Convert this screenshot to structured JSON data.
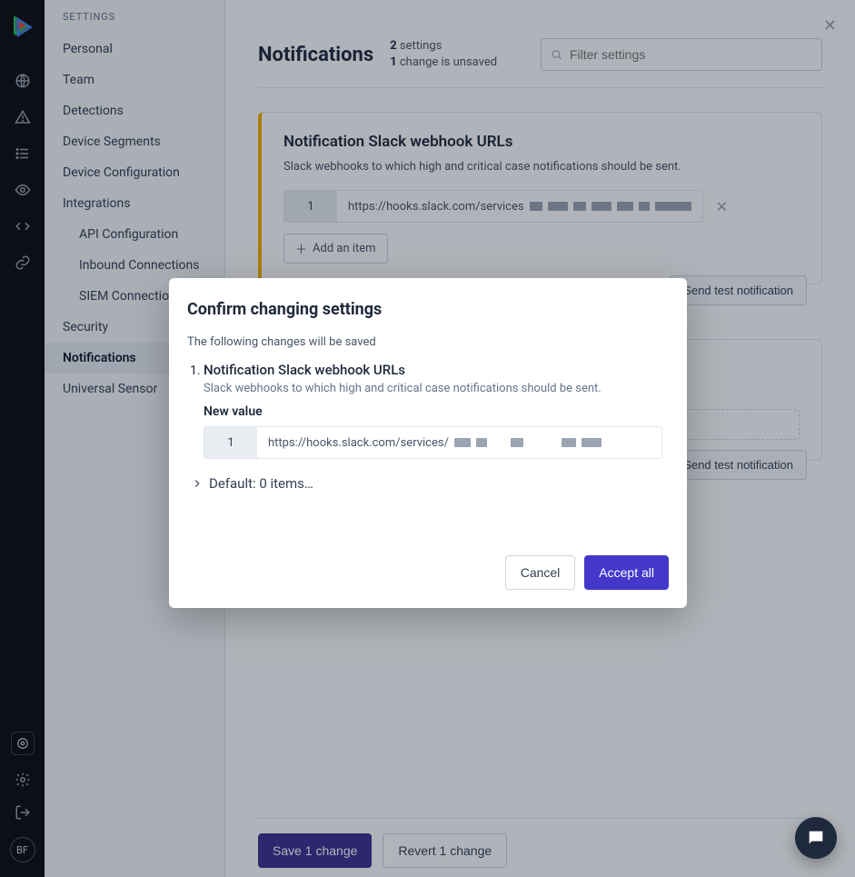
{
  "rail": {
    "avatar_initials": "BF"
  },
  "sidebar": {
    "header": "SETTINGS",
    "items": [
      {
        "label": "Personal"
      },
      {
        "label": "Team"
      },
      {
        "label": "Detections"
      },
      {
        "label": "Device Segments"
      },
      {
        "label": "Device Configuration"
      },
      {
        "label": "Integrations"
      },
      {
        "label": "API Configuration",
        "sub": true
      },
      {
        "label": "Inbound Connections",
        "sub": true
      },
      {
        "label": "SIEM Connections",
        "sub": true
      },
      {
        "label": "Security"
      },
      {
        "label": "Notifications",
        "active": true
      },
      {
        "label": "Universal Sensor"
      }
    ]
  },
  "page": {
    "title": "Notifications",
    "meta_settings_count": "2",
    "meta_settings_label": " settings",
    "meta_unsaved_count": "1",
    "meta_unsaved_label": " change is unsaved",
    "filter_placeholder": "Filter settings"
  },
  "card1": {
    "title": "Notification Slack webhook URLs",
    "desc": "Slack webhooks to which high and critical case notifications should be sent.",
    "row_index": "1",
    "row_value_prefix": "https://hooks.slack.com/services",
    "add_label": "Add an item",
    "send_test_label": "Send test notification"
  },
  "card2": {
    "send_test_label": "Send test notification"
  },
  "footer": {
    "save_label": "Save 1 change",
    "revert_label": "Revert 1 change"
  },
  "modal": {
    "title": "Confirm changing settings",
    "subtitle": "The following changes will be saved",
    "change_name": "Notification Slack webhook URLs",
    "change_desc": "Slack webhooks to which high and critical case notifications should be sent.",
    "new_value_label": "New value",
    "row_index": "1",
    "row_value_prefix": "https://hooks.slack.com/services/",
    "default_label": "Default: 0 items…",
    "cancel_label": "Cancel",
    "accept_label": "Accept all"
  }
}
